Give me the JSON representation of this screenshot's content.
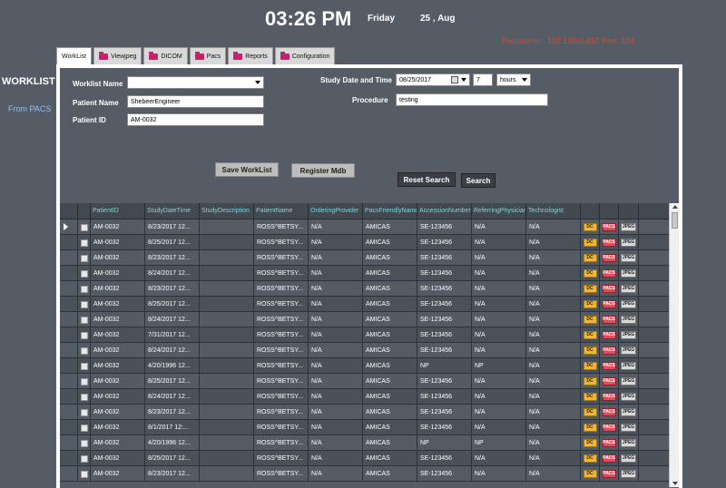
{
  "header": {
    "time": "03:26 PM",
    "day": "Friday",
    "date": "25 , Aug",
    "pacs_status": "Pacsname : 182.168.0.452   Port :104"
  },
  "sidebar": {
    "title": "WORKLIST",
    "link": "From PACS"
  },
  "tabs": [
    {
      "label": "WorkList",
      "active": true,
      "icon": "none"
    },
    {
      "label": "Viewjpeg",
      "icon": "folder-icon"
    },
    {
      "label": "DICOM",
      "icon": "folder-icon"
    },
    {
      "label": "Pacs",
      "icon": "folder-icon"
    },
    {
      "label": "Reports",
      "icon": "folder-icon"
    },
    {
      "label": "Configuration",
      "icon": "folder-icon"
    }
  ],
  "form": {
    "worklist_name_label": "Worklist Name",
    "worklist_name_value": "",
    "patient_name_label": "Patient Name",
    "patient_name_value": "ShebeerEngineer",
    "patient_id_label": "Patient ID",
    "patient_id_value": "AM-0032",
    "study_date_label": "Study Date and Time",
    "study_date_value": "08/25/2017",
    "duration_value": "7",
    "duration_unit": "hours",
    "procedure_label": "Procedure",
    "procedure_value": "testing"
  },
  "buttons": {
    "save_worklist": "Save WorkList",
    "register_mdb": "Register Mdb",
    "reset_search": "Reset Search",
    "search": "Search"
  },
  "grid": {
    "columns": [
      "PatientID",
      "StudyDateTime",
      "StudyDescription",
      "PatientName",
      "OrderingProvider",
      "PacsFriendlyName",
      "AccessionNumber",
      "ReferringPhysician",
      "Technologist"
    ],
    "action_labels": {
      "dc": "DC",
      "pacs": "PACS",
      "jpeg": "JPEG"
    },
    "rows": [
      [
        "AM-0032",
        "8/23/2017 12...",
        "",
        "ROSS^BETSY...",
        "N/A",
        "AMICAS",
        "SE-123456",
        "N/A",
        "N/A"
      ],
      [
        "AM-0032",
        "8/25/2017 12...",
        "",
        "ROSS^BETSY...",
        "N/A",
        "AMICAS",
        "SE-123456",
        "N/A",
        "N/A"
      ],
      [
        "AM-0032",
        "8/23/2017 12...",
        "",
        "ROSS^BETSY...",
        "N/A",
        "AMICAS",
        "SE-123456",
        "N/A",
        "N/A"
      ],
      [
        "AM-0032",
        "8/24/2017 12...",
        "",
        "ROSS^BETSY...",
        "N/A",
        "AMICAS",
        "SE-123456",
        "N/A",
        "N/A"
      ],
      [
        "AM-0032",
        "8/23/2017 12...",
        "",
        "ROSS^BETSY...",
        "N/A",
        "AMICAS",
        "SE-123456",
        "N/A",
        "N/A"
      ],
      [
        "AM-0032",
        "8/25/2017 12...",
        "",
        "ROSS^BETSY...",
        "N/A",
        "AMICAS",
        "SE-123456",
        "N/A",
        "N/A"
      ],
      [
        "AM-0032",
        "8/24/2017 12...",
        "",
        "ROSS^BETSY...",
        "N/A",
        "AMICAS",
        "SE-123456",
        "N/A",
        "N/A"
      ],
      [
        "AM-0032",
        "7/31/2017 12...",
        "",
        "ROSS^BETSY...",
        "N/A",
        "AMICAS",
        "SE-123456",
        "N/A",
        "N/A"
      ],
      [
        "AM-0032",
        "8/24/2017 12...",
        "",
        "ROSS^BETSY...",
        "N/A",
        "AMICAS",
        "SE-123456",
        "N/A",
        "N/A"
      ],
      [
        "AM-0032",
        "4/20/1996 12...",
        "",
        "ROSS^BETSY...",
        "N/A",
        "AMICAS",
        "NP",
        "NP",
        "N/A"
      ],
      [
        "AM-0032",
        "8/25/2017 12...",
        "",
        "ROSS^BETSY...",
        "N/A",
        "AMICAS",
        "SE-123456",
        "N/A",
        "N/A"
      ],
      [
        "AM-0032",
        "8/24/2017 12...",
        "",
        "ROSS^BETSY...",
        "N/A",
        "AMICAS",
        "SE-123456",
        "N/A",
        "N/A"
      ],
      [
        "AM-0032",
        "8/23/2017 12...",
        "",
        "ROSS^BETSY...",
        "N/A",
        "AMICAS",
        "SE-123456",
        "N/A",
        "N/A"
      ],
      [
        "AM-0032",
        "8/1/2017 12:...",
        "",
        "ROSS^BETSY...",
        "N/A",
        "AMICAS",
        "SE-123456",
        "N/A",
        "N/A"
      ],
      [
        "AM-0032",
        "4/20/1996 12...",
        "",
        "ROSS^BETSY...",
        "N/A",
        "AMICAS",
        "NP",
        "NP",
        "N/A"
      ],
      [
        "AM-0032",
        "8/25/2017 12...",
        "",
        "ROSS^BETSY...",
        "N/A",
        "AMICAS",
        "SE-123456",
        "N/A",
        "N/A"
      ],
      [
        "AM-0032",
        "8/23/2017 12...",
        "",
        "ROSS^BETSY...",
        "N/A",
        "AMICAS",
        "SE-123456",
        "N/A",
        "N/A"
      ]
    ]
  }
}
